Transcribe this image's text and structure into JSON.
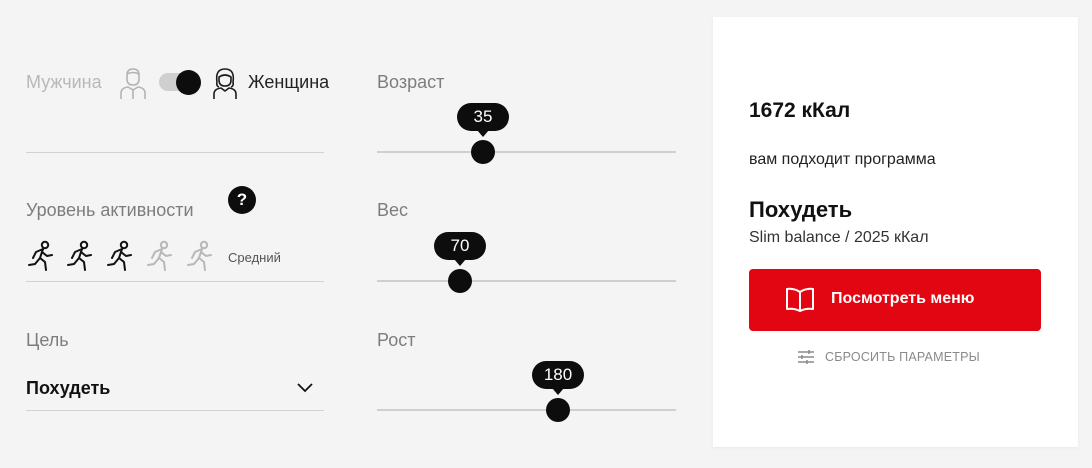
{
  "gender": {
    "male_label": "Мужчина",
    "female_label": "Женщина",
    "selected": "female",
    "male_icon": "male-user-icon",
    "female_icon": "female-user-icon"
  },
  "activity": {
    "label": "Уровень активности",
    "help_symbol": "?",
    "level_text": "Средний",
    "level": 3,
    "max_level": 5,
    "icon": "running-person-icon"
  },
  "goal": {
    "label": "Цель",
    "value": "Похудеть",
    "icon": "chevron-down-icon"
  },
  "sliders": {
    "age": {
      "label": "Возраст",
      "value": "35"
    },
    "weight": {
      "label": "Вес",
      "value": "70"
    },
    "height": {
      "label": "Рост",
      "value": "180"
    }
  },
  "result": {
    "calories": "1672 кКал",
    "subtitle": "вам подходит программа",
    "program_title": "Похудеть",
    "program_detail": "Slim balance / 2025 кКал",
    "menu_button": "Посмотреть меню",
    "reset_label": "СБРОСИТЬ ПАРАМЕТРЫ"
  },
  "colors": {
    "accent": "#e20612",
    "dark": "#0d0d0d",
    "background": "#f4f4f4"
  }
}
